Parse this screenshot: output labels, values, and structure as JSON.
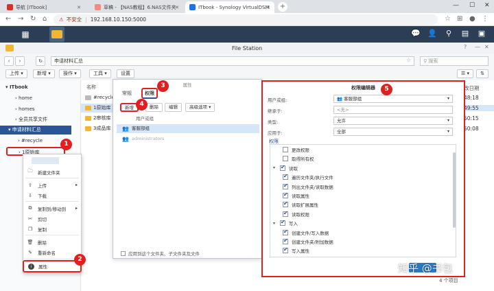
{
  "browser": {
    "tabs": [
      {
        "label": "导航 [ITbook]",
        "color": "#d93025"
      },
      {
        "label": "草稿 - 【NAS教程】6.NAS文件夹",
        "color": "#f28b82"
      },
      {
        "label": "ITbook - Synology VirtualDSM",
        "color": "#1a73e8"
      }
    ],
    "new_tab": "+",
    "insecure_label": "不安全",
    "url": "192.168.10.150:5000"
  },
  "filestation": {
    "title": "File Station",
    "path": "申请材料汇总",
    "search_placeholder": "搜索",
    "toolbar": [
      "上传",
      "新增",
      "操作",
      "工具",
      "设置"
    ],
    "sidebar": {
      "root": "ITbook",
      "items": [
        "home",
        "homes",
        "全员共享文件",
        "申请材料汇总",
        "#recycle",
        "1原始库"
      ]
    },
    "column_name": "名称",
    "column_time": "改日期",
    "files": [
      "#recycle",
      "1原始库",
      "2审核库",
      "3成品库"
    ],
    "times": [
      "48:18",
      "49:55",
      "50:15",
      "50:08"
    ],
    "status": "4 个项目"
  },
  "properties_dialog": {
    "title": "属性",
    "tabs": [
      "常规",
      "权限"
    ],
    "buttons": [
      "新增",
      "删除",
      "编辑",
      "高级选项"
    ],
    "user_header": "用户或组",
    "rows": [
      "客服部组",
      "administrators"
    ],
    "footer": "应用到这个文件夹、子文件夹及文件"
  },
  "permission_editor": {
    "title": "权限编辑器",
    "fields": [
      {
        "label": "用户或组:",
        "value": "客服部组"
      },
      {
        "label": "继承于:",
        "value": "<无>"
      },
      {
        "label": "类型:",
        "value": "允许"
      },
      {
        "label": "应用于:",
        "value": "全部"
      }
    ],
    "section": "权限",
    "items": [
      {
        "label": "更改权限",
        "checked": false,
        "level": 1
      },
      {
        "label": "取得所有权",
        "checked": false,
        "level": 1
      },
      {
        "label": "读取",
        "checked": true,
        "level": 0
      },
      {
        "label": "遍历文件夹/执行文件",
        "checked": true,
        "level": 1
      },
      {
        "label": "列出文件夹/读取数据",
        "checked": true,
        "level": 1
      },
      {
        "label": "读取属性",
        "checked": true,
        "level": 1
      },
      {
        "label": "读取扩展属性",
        "checked": true,
        "level": 1
      },
      {
        "label": "读取权限",
        "checked": true,
        "level": 1
      },
      {
        "label": "写入",
        "checked": true,
        "level": 0
      },
      {
        "label": "创建文件/写入数据",
        "checked": true,
        "level": 1
      },
      {
        "label": "创建文件夹/附加数据",
        "checked": true,
        "level": 1
      },
      {
        "label": "写入属性",
        "checked": true,
        "level": 1
      }
    ]
  },
  "context_menu": {
    "items": [
      {
        "label": "新建文件夹",
        "icon": "folder-plus-icon"
      },
      {
        "label": "上传",
        "icon": "upload-icon"
      },
      {
        "label": "下载",
        "icon": "download-icon"
      },
      {
        "label": "复制到/移动到",
        "icon": "copy-move-icon"
      },
      {
        "label": "剪切",
        "icon": "cut-icon"
      },
      {
        "label": "复制",
        "icon": "copy-icon"
      },
      {
        "label": "删除",
        "icon": "trash-icon"
      },
      {
        "label": "重新命名",
        "icon": "rename-icon"
      },
      {
        "label": "属性",
        "icon": "info-icon"
      }
    ]
  },
  "annotations": [
    "1",
    "2",
    "3",
    "4",
    "5"
  ],
  "watermark": "知乎 @书包",
  "colors": {
    "accent": "#2b5597",
    "annotation": "#e02020",
    "dsm_bar": "#2b3e55"
  }
}
